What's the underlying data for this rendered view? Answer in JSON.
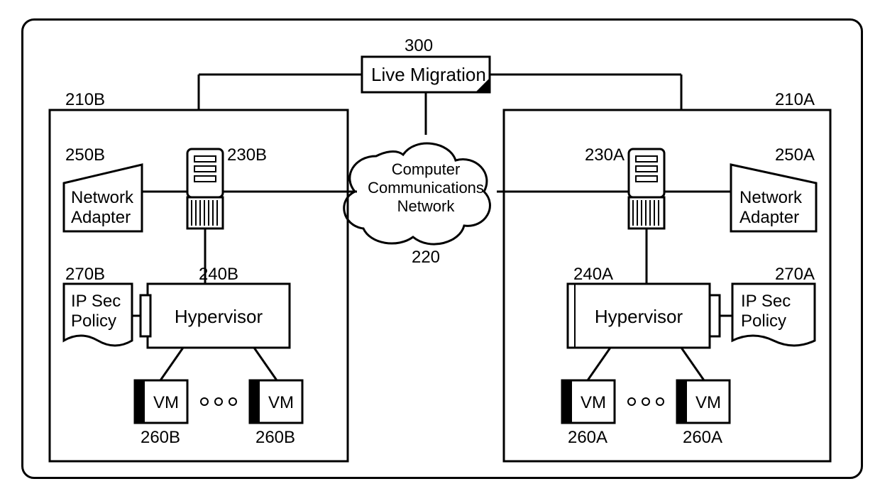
{
  "top": {
    "ref": "300",
    "label": "Live Migration"
  },
  "cloud": {
    "line1": "Computer",
    "line2": "Communications",
    "line3": "Network",
    "ref": "220"
  },
  "hostB": {
    "ref": "210B",
    "server_ref": "230B",
    "adapter_ref": "250B",
    "adapter_line1": "Network",
    "adapter_line2": "Adapter",
    "hypervisor_ref": "240B",
    "hypervisor_label": "Hypervisor",
    "policy_ref": "270B",
    "policy_line1": "IP Sec",
    "policy_line2": "Policy",
    "vm_ref1": "260B",
    "vm_ref2": "260B",
    "vm_label": "VM"
  },
  "hostA": {
    "ref": "210A",
    "server_ref": "230A",
    "adapter_ref": "250A",
    "adapter_line1": "Network",
    "adapter_line2": "Adapter",
    "hypervisor_ref": "240A",
    "hypervisor_label": "Hypervisor",
    "policy_ref": "270A",
    "policy_line1": "IP Sec",
    "policy_line2": "Policy",
    "vm_ref1": "260A",
    "vm_ref2": "260A",
    "vm_label": "VM"
  },
  "ellipsis": "○ ○ ○"
}
